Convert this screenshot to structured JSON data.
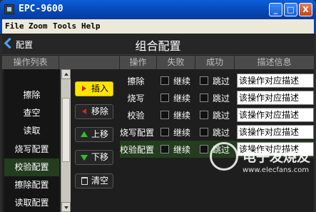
{
  "window": {
    "title": "EPC-9600",
    "minimize_label": "_",
    "maximize_label": "□",
    "close_label": "X"
  },
  "menu": [
    "File",
    "Zoom",
    "Tools",
    "Help"
  ],
  "header": {
    "back_label": "配置",
    "title": "组合配置"
  },
  "columns": {
    "list": "操作列表",
    "op": "操作",
    "fail": "失败",
    "success": "成功",
    "desc": "描述信息"
  },
  "list_items": [
    "擦除",
    "查空",
    "读取",
    "烧写配置",
    "校验配置",
    "擦除配置",
    "读取配置"
  ],
  "list_selected": "校验配置",
  "buttons": {
    "insert": "插入",
    "remove": "移除",
    "move_up": "上移",
    "move_down": "下移",
    "clear": "清空"
  },
  "rows": [
    {
      "op": "擦除",
      "fail": "继续",
      "success": "跳过",
      "desc": "该操作对应描述"
    },
    {
      "op": "烧写",
      "fail": "继续",
      "success": "跳过",
      "desc": "该操作对应描述"
    },
    {
      "op": "校验",
      "fail": "继续",
      "success": "跳过",
      "desc": "该操作对应描述"
    },
    {
      "op": "烧写配置",
      "fail": "继续",
      "success": "跳过",
      "desc": "该操作对应描述"
    },
    {
      "op": "校验配置",
      "fail": "继续",
      "success": "跳过",
      "desc": "该操作对应描述"
    }
  ],
  "watermark": {
    "text": "电子发烧友",
    "url": "www.elecfans.com"
  },
  "colors": {
    "accent": "#4aa3ff",
    "primary_button": "#ffe400",
    "selected_row": "#243d1e",
    "titlebar": "#0746b4"
  }
}
